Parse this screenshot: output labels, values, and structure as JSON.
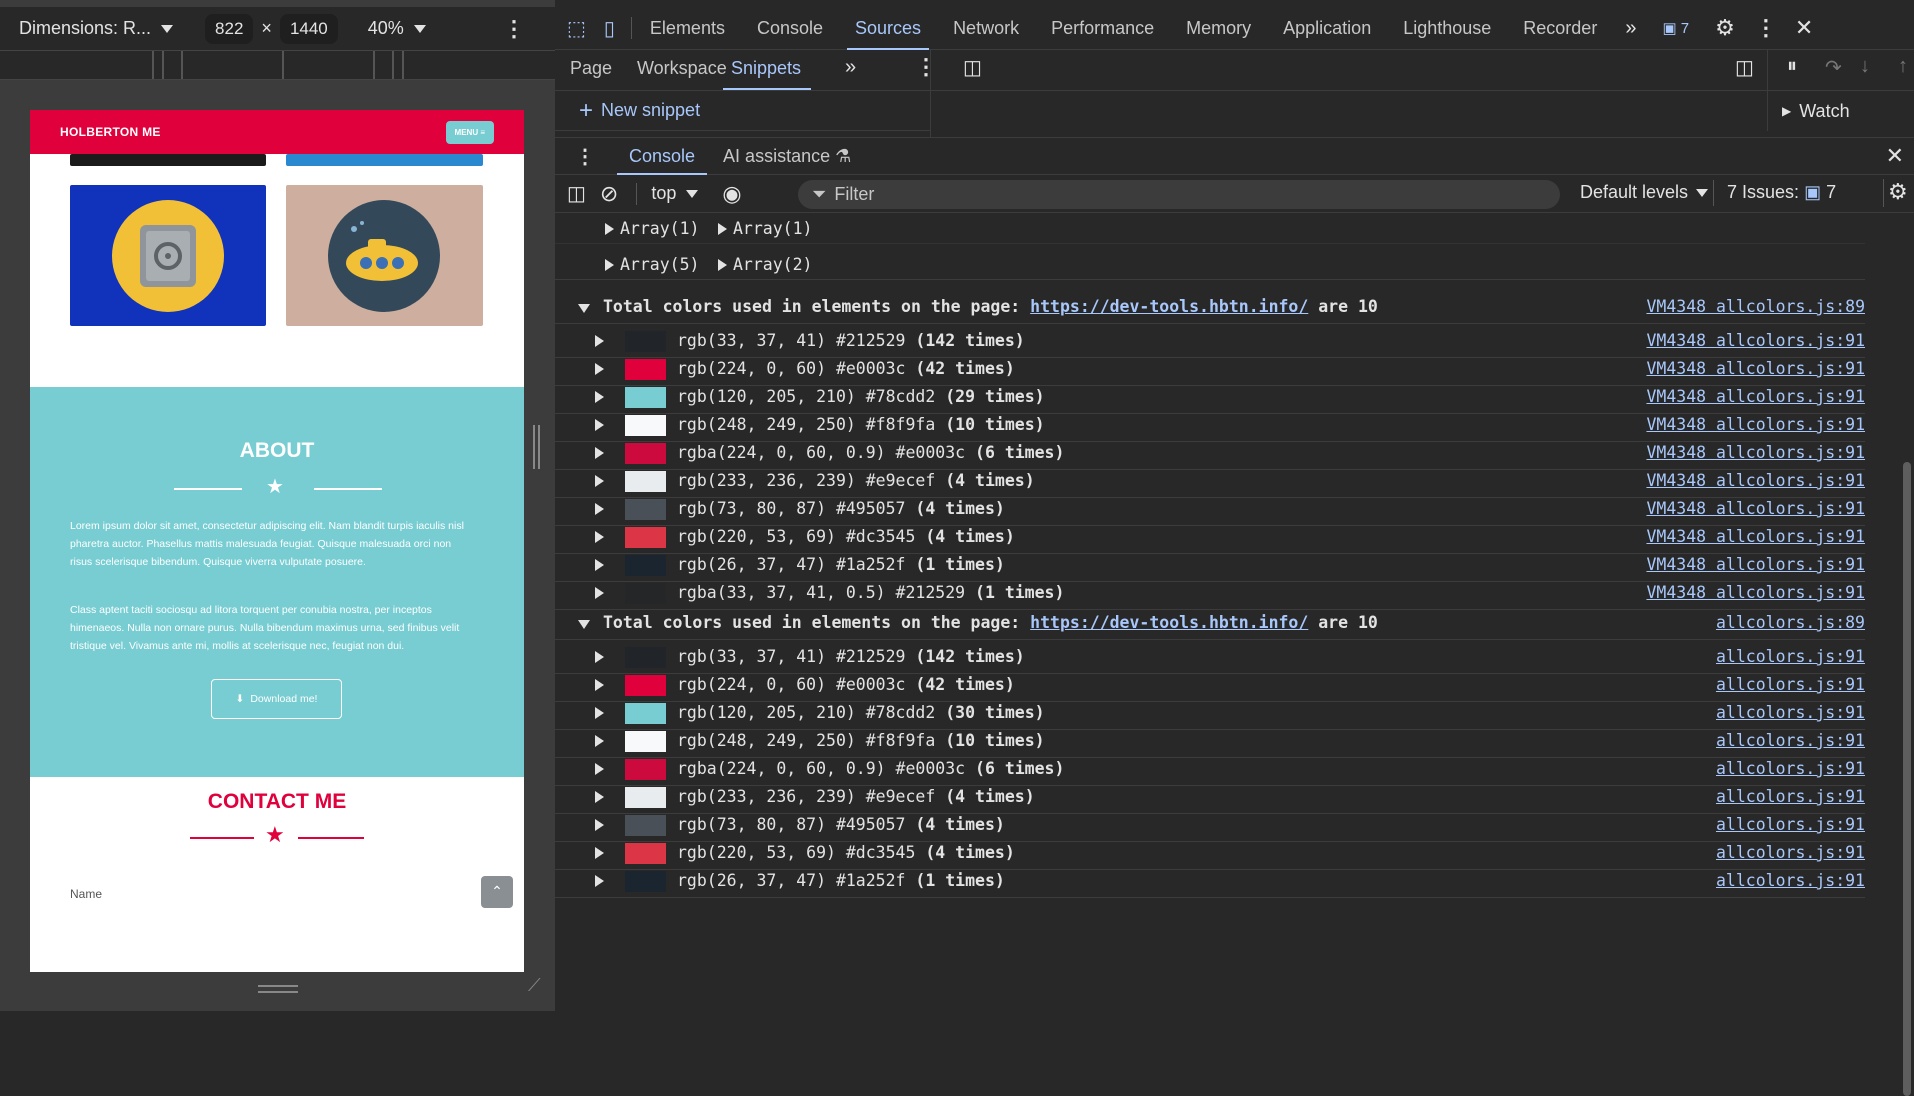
{
  "device_toolbar": {
    "dimensions_label": "Dimensions: R...",
    "width": "822",
    "times": "×",
    "height": "1440",
    "zoom": "40%"
  },
  "site": {
    "logo": "HOLBERTON ME",
    "menu": "MENU ≡",
    "about_title": "ABOUT",
    "about_p1": "Lorem ipsum dolor sit amet, consectetur adipiscing elit. Nam blandit turpis iaculis nisl pharetra auctor. Phasellus mattis malesuada feugiat. Quisque malesuada orci non risus scelerisque bibendum. Quisque viverra vulputate posuere.",
    "about_p2": "Class aptent taciti sociosqu ad litora torquent per conubia nostra, per inceptos himenaeos. Nulla non ornare purus. Nulla bibendum maximus urna, sed finibus velit tristique vel. Vivamus ante mi, mollis at scelerisque nec, feugiat non dui.",
    "download_label": "Download me!",
    "contact_title": "CONTACT ME",
    "name_label": "Name"
  },
  "devtools": {
    "tabs": [
      "Elements",
      "Console",
      "Sources",
      "Network",
      "Performance",
      "Memory",
      "Application",
      "Lighthouse",
      "Recorder"
    ],
    "active_tab": "Sources",
    "issues_badge": "7",
    "sources_tabs": [
      "Page",
      "Workspace",
      "Snippets"
    ],
    "active_sources_tab": "Snippets",
    "new_snippet": "New snippet",
    "watch": "Watch",
    "drawer_tabs": [
      "Console",
      "AI assistance"
    ],
    "context": "top",
    "filter_placeholder": "Filter",
    "levels": "Default levels",
    "issues_label": "7 Issues:",
    "issues_count": "7"
  },
  "console": {
    "arrays_row1": [
      "Array(1)",
      "Array(1)"
    ],
    "arrays_row2": [
      "Array(5)",
      "Array(2)"
    ],
    "groups": [
      {
        "header_prefix": "Total colors used in elements on the page: ",
        "url": "https://dev-tools.hbtn.info/",
        "header_suffix": " are 10",
        "source": "VM4348 allcolors.js:89",
        "entries": [
          {
            "text": "rgb(33, 37, 41) #212529 ",
            "count": "(142 times)",
            "color": "#212529",
            "source": "VM4348 allcolors.js:91"
          },
          {
            "text": "rgb(224, 0, 60) #e0003c ",
            "count": "(42 times)",
            "color": "#e0003c",
            "source": "VM4348 allcolors.js:91"
          },
          {
            "text": "rgb(120, 205, 210) #78cdd2 ",
            "count": "(29 times)",
            "color": "#78cdd2",
            "source": "VM4348 allcolors.js:91"
          },
          {
            "text": "rgb(248, 249, 250) #f8f9fa ",
            "count": "(10 times)",
            "color": "#f8f9fa",
            "source": "VM4348 allcolors.js:91"
          },
          {
            "text": "rgba(224, 0, 60, 0.9) #e0003c ",
            "count": "(6 times)",
            "color": "#cc0a3d",
            "source": "VM4348 allcolors.js:91"
          },
          {
            "text": "rgb(233, 236, 239) #e9ecef ",
            "count": "(4 times)",
            "color": "#e9ecef",
            "source": "VM4348 allcolors.js:91"
          },
          {
            "text": "rgb(73, 80, 87) #495057 ",
            "count": "(4 times)",
            "color": "#495057",
            "source": "VM4348 allcolors.js:91"
          },
          {
            "text": "rgb(220, 53, 69) #dc3545 ",
            "count": "(4 times)",
            "color": "#dc3545",
            "source": "VM4348 allcolors.js:91"
          },
          {
            "text": "rgb(26, 37, 47) #1a252f ",
            "count": "(1 times)",
            "color": "#1a252f",
            "source": "VM4348 allcolors.js:91"
          },
          {
            "text": "rgba(33, 37, 41, 0.5) #212529 ",
            "count": "(1 times)",
            "color": "#252628",
            "source": "VM4348 allcolors.js:91"
          }
        ]
      },
      {
        "header_prefix": "Total colors used in elements on the page: ",
        "url": "https://dev-tools.hbtn.info/",
        "header_suffix": " are 10",
        "source": "allcolors.js:89",
        "entries": [
          {
            "text": "rgb(33, 37, 41) #212529 ",
            "count": "(142 times)",
            "color": "#212529",
            "source": "allcolors.js:91"
          },
          {
            "text": "rgb(224, 0, 60) #e0003c ",
            "count": "(42 times)",
            "color": "#e0003c",
            "source": "allcolors.js:91"
          },
          {
            "text": "rgb(120, 205, 210) #78cdd2 ",
            "count": "(30 times)",
            "color": "#78cdd2",
            "source": "allcolors.js:91"
          },
          {
            "text": "rgb(248, 249, 250) #f8f9fa ",
            "count": "(10 times)",
            "color": "#f8f9fa",
            "source": "allcolors.js:91"
          },
          {
            "text": "rgba(224, 0, 60, 0.9) #e0003c ",
            "count": "(6 times)",
            "color": "#cc0a3d",
            "source": "allcolors.js:91"
          },
          {
            "text": "rgb(233, 236, 239) #e9ecef ",
            "count": "(4 times)",
            "color": "#e9ecef",
            "source": "allcolors.js:91"
          },
          {
            "text": "rgb(73, 80, 87) #495057 ",
            "count": "(4 times)",
            "color": "#495057",
            "source": "allcolors.js:91"
          },
          {
            "text": "rgb(220, 53, 69) #dc3545 ",
            "count": "(4 times)",
            "color": "#dc3545",
            "source": "allcolors.js:91"
          },
          {
            "text": "rgb(26, 37, 47) #1a252f ",
            "count": "(1 times)",
            "color": "#1a252f",
            "source": "allcolors.js:91"
          }
        ]
      }
    ]
  }
}
